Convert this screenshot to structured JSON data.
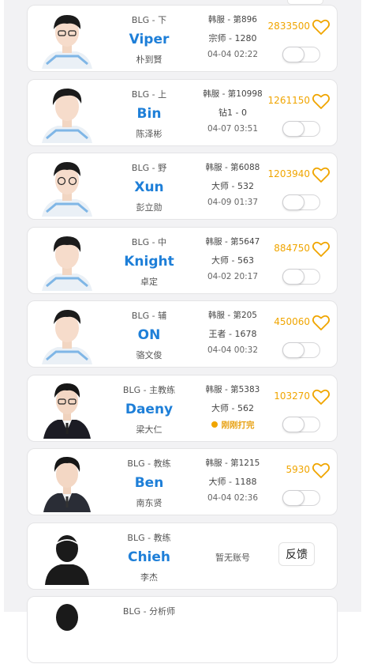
{
  "players": [
    {
      "team_role": "BLG - 下",
      "name": "Viper",
      "real_name": "朴到賢",
      "server": "韩服 - 第896",
      "tier": "宗师 - 1280",
      "time": "04-04 02:22",
      "likes": "2833500",
      "liked": false,
      "subscribed": false
    },
    {
      "team_role": "BLG - 上",
      "name": "Bin",
      "real_name": "陈泽彬",
      "server": "韩服 - 第10998",
      "tier": "钻1 - 0",
      "time": "04-07 03:51",
      "likes": "1261150",
      "liked": false,
      "subscribed": false
    },
    {
      "team_role": "BLG - 野",
      "name": "Xun",
      "real_name": "彭立勋",
      "server": "韩服 - 第6088",
      "tier": "大师 - 532",
      "time": "04-09 01:37",
      "likes": "1203940",
      "liked": false,
      "subscribed": false
    },
    {
      "team_role": "BLG - 中",
      "name": "Knight",
      "real_name": "卓定",
      "server": "韩服 - 第5647",
      "tier": "大师 - 563",
      "time": "04-02 20:17",
      "likes": "884750",
      "liked": false,
      "subscribed": false
    },
    {
      "team_role": "BLG - 辅",
      "name": "ON",
      "real_name": "骆文俊",
      "server": "韩服 - 第205",
      "tier": "王者 - 1678",
      "time": "04-04 00:32",
      "likes": "450060",
      "liked": false,
      "subscribed": false
    },
    {
      "team_role": "BLG - 主教练",
      "name": "Daeny",
      "real_name": "梁大仁",
      "server": "韩服 - 第5383",
      "tier": "大师 - 562",
      "status": "刚刚打完",
      "likes": "103270",
      "liked": false,
      "subscribed": false
    },
    {
      "team_role": "BLG - 教练",
      "name": "Ben",
      "real_name": "南东贤",
      "server": "韩服 - 第1215",
      "tier": "大师 - 1188",
      "time": "04-04 02:36",
      "likes": "5930",
      "liked": false,
      "subscribed": false
    },
    {
      "team_role": "BLG - 教练",
      "name": "Chieh",
      "real_name": "李杰",
      "no_account": "暂无账号",
      "feedback_label": "反馈"
    },
    {
      "team_role": "BLG - 分析师"
    }
  ],
  "colors": {
    "accent_blue": "#1e7fd8",
    "like_orange": "#f0a500",
    "status_orange": "#e8a317"
  },
  "icons": {
    "like": "heart-outline-icon",
    "default_avatar": "person-silhouette-icon"
  }
}
